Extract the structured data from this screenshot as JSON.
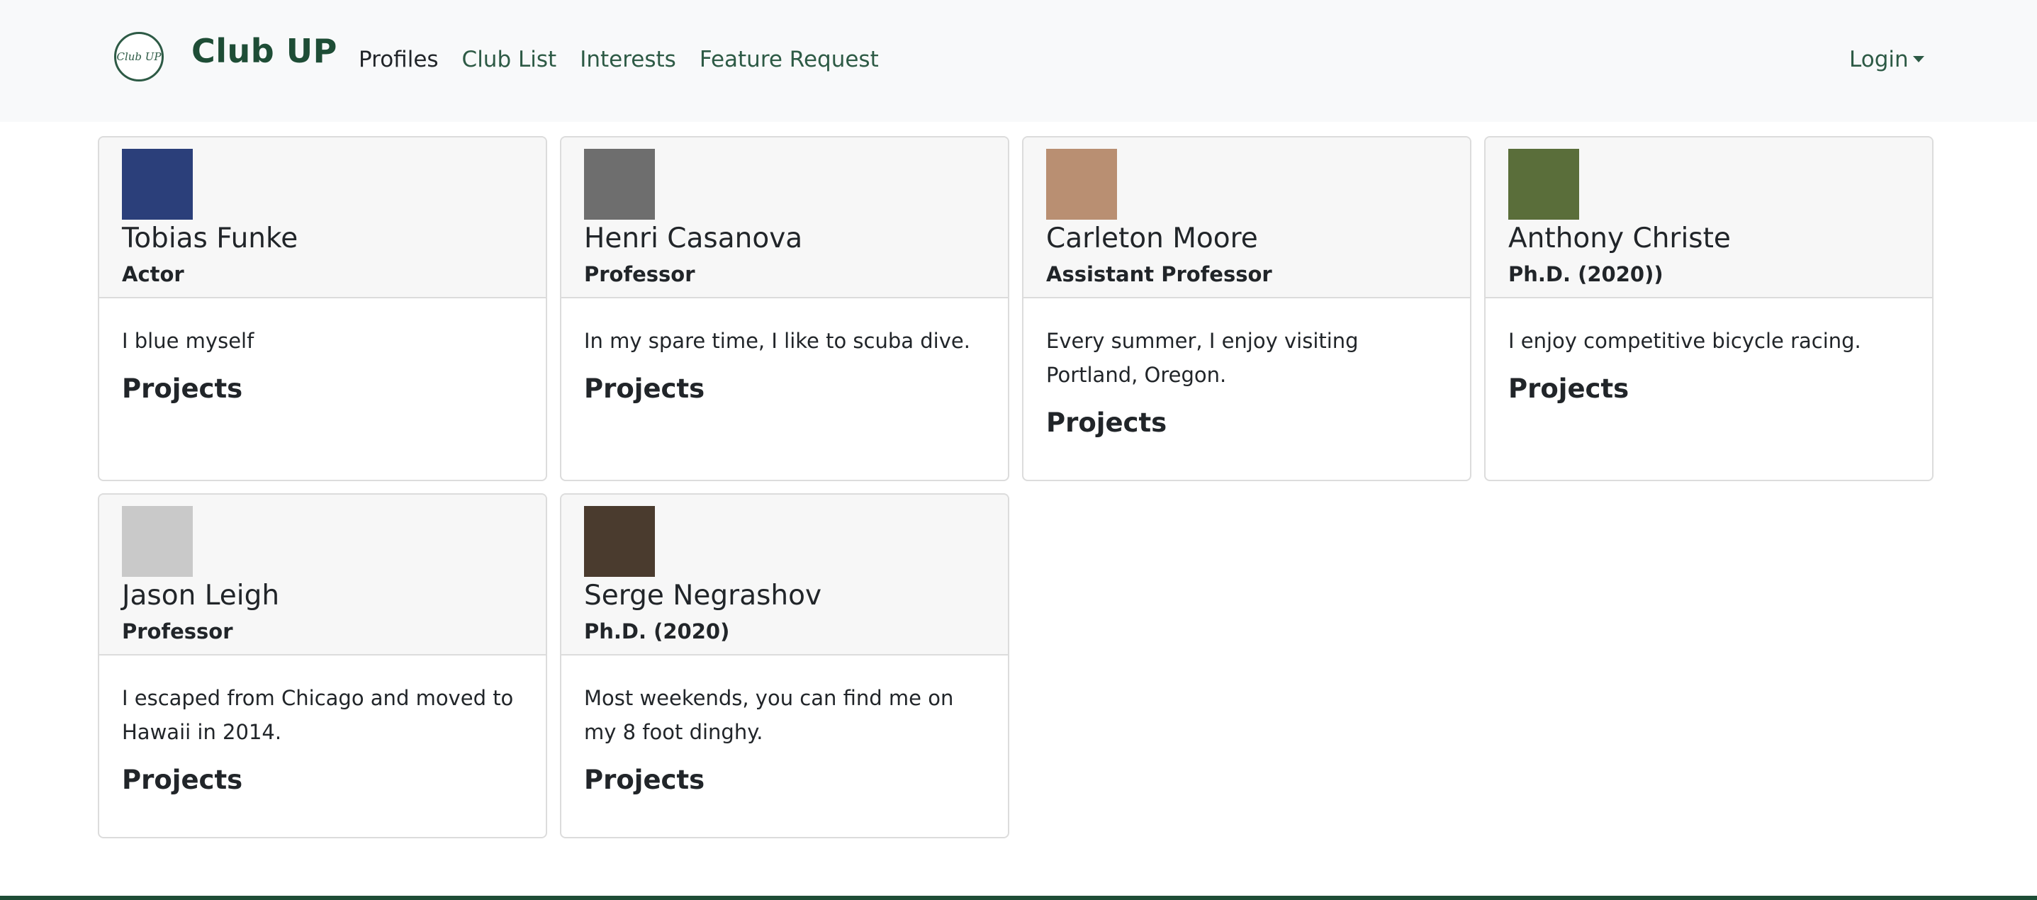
{
  "navbar": {
    "logo_text": "Club UP",
    "brand": "Club UP",
    "links": [
      "Profiles",
      "Club List",
      "Interests",
      "Feature Request"
    ],
    "active_link": "Profiles",
    "login_label": "Login"
  },
  "profiles": [
    {
      "name": "Tobias Funke",
      "title": "Actor",
      "bio": "I blue myself",
      "projects_label": "Projects",
      "avatar_color": "#2b3f7a"
    },
    {
      "name": "Henri Casanova",
      "title": "Professor",
      "bio": "In my spare time, I like to scuba dive.",
      "projects_label": "Projects",
      "avatar_color": "#6e6e6e"
    },
    {
      "name": "Carleton Moore",
      "title": "Assistant Professor",
      "bio": "Every summer, I enjoy visiting Portland, Oregon.",
      "projects_label": "Projects",
      "avatar_color": "#b98f72"
    },
    {
      "name": "Anthony Christe",
      "title": "Ph.D. (2020))",
      "bio": "I enjoy competitive bicycle racing.",
      "projects_label": "Projects",
      "avatar_color": "#5a6e3a"
    },
    {
      "name": "Jason Leigh",
      "title": "Professor",
      "bio": "I escaped from Chicago and moved to Hawaii in 2014.",
      "projects_label": "Projects",
      "avatar_color": "#c9c9c9"
    },
    {
      "name": "Serge Negrashov",
      "title": "Ph.D. (2020)",
      "bio": "Most weekends, you can find me on my 8 foot dinghy.",
      "projects_label": "Projects",
      "avatar_color": "#4a3b2e"
    }
  ]
}
